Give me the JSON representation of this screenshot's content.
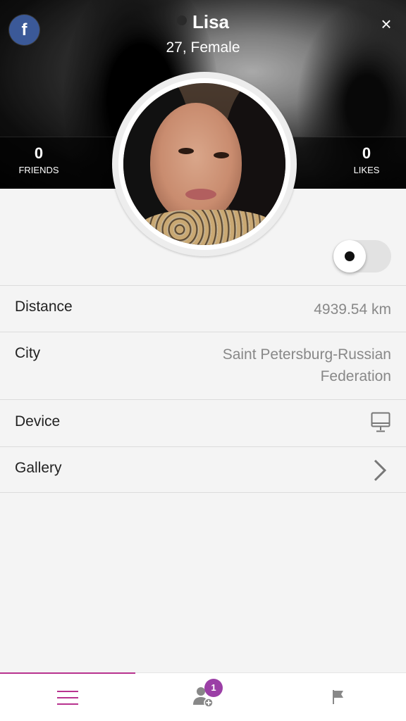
{
  "profile": {
    "name": "Lisa",
    "age_gender": "27, Female",
    "facebook_label": "f",
    "close_label": "×"
  },
  "stats": {
    "friends": {
      "count": "0",
      "label": "FRIENDS"
    },
    "likes": {
      "count": "0",
      "label": "LIKES"
    }
  },
  "details": [
    {
      "label": "Distance",
      "value": "4939.54 km"
    },
    {
      "label": "City",
      "value": "Saint Petersburg-Russian Federation"
    },
    {
      "label": "Device",
      "icon": "desktop-monitor-icon"
    },
    {
      "label": "Gallery",
      "icon": "chevron-right-icon"
    }
  ],
  "toggle": {
    "state": "off"
  },
  "bottom_nav": {
    "tabs": [
      {
        "name": "menu",
        "icon": "hamburger-menu-icon",
        "active": true
      },
      {
        "name": "friend-requests",
        "icon": "add-user-icon",
        "badge": "1"
      },
      {
        "name": "report",
        "icon": "flag-icon"
      }
    ]
  },
  "colors": {
    "facebook": "#3b5998",
    "accent": "#b8338f",
    "badge": "#9b3fa6",
    "value_text": "#888888"
  }
}
